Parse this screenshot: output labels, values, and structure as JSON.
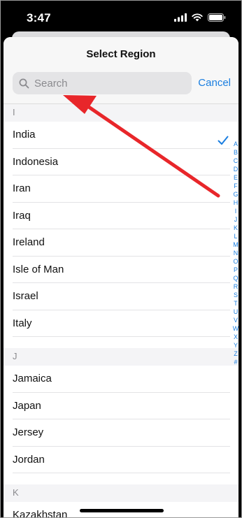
{
  "status_bar": {
    "time": "3:47",
    "icons": [
      "signal-icon",
      "wifi-icon",
      "battery-icon"
    ]
  },
  "sheet": {
    "title": "Select Region",
    "search": {
      "placeholder": "Search",
      "value": ""
    },
    "cancel_label": "Cancel",
    "selected": "India",
    "sections": [
      {
        "letter": "I",
        "items": [
          "India",
          "Indonesia",
          "Iran",
          "Iraq",
          "Ireland",
          "Isle of Man",
          "Israel",
          "Italy"
        ]
      },
      {
        "letter": "J",
        "items": [
          "Jamaica",
          "Japan",
          "Jersey",
          "Jordan"
        ]
      },
      {
        "letter": "K",
        "items": [
          "Kazakhstan"
        ]
      }
    ]
  },
  "index_letters": [
    "A",
    "B",
    "C",
    "D",
    "E",
    "F",
    "G",
    "H",
    "I",
    "J",
    "K",
    "L",
    "M",
    "N",
    "O",
    "P",
    "Q",
    "R",
    "S",
    "T",
    "U",
    "V",
    "W",
    "X",
    "Y",
    "Z",
    "#"
  ],
  "colors": {
    "accent": "#1a7ee0",
    "annotation_arrow": "#e8262a"
  }
}
